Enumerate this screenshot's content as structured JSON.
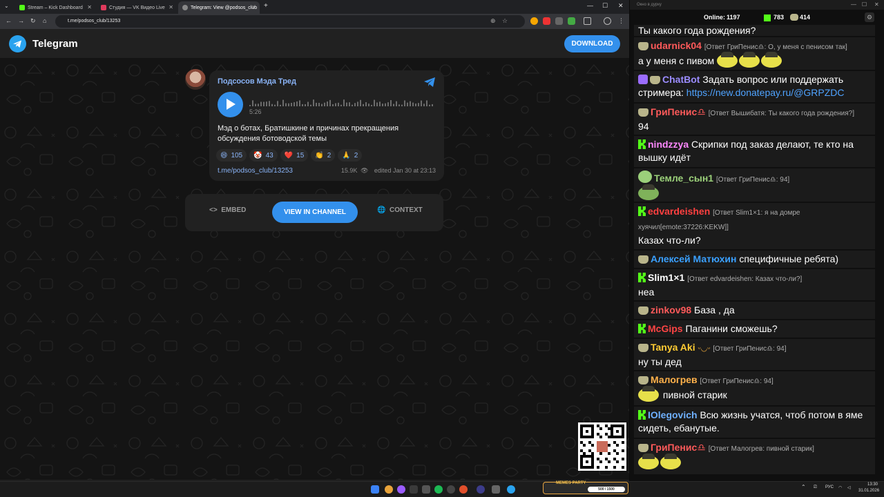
{
  "browser": {
    "tabs": [
      {
        "label": "Stream – Kick Dashboard",
        "color": "#53fc18"
      },
      {
        "label": "Студия — VK Видео Live",
        "color": "#e03a5c"
      },
      {
        "label": "Telegram: View @podsos_club",
        "color": "#888888"
      }
    ],
    "url": "t.me/podsos_club/13253",
    "new_tab": "+"
  },
  "telegram": {
    "brand": "Telegram",
    "download": "DOWNLOAD",
    "channel": "Подсосов Мэда Тред",
    "duration": "5:26",
    "message": "Мэд о ботах, Братишкине и причинах прекращения обсуждения ботоводской темы",
    "reactions": [
      {
        "emoji": "😄",
        "count": "105"
      },
      {
        "emoji": "🤡",
        "count": "43"
      },
      {
        "emoji": "❤️",
        "count": "15"
      },
      {
        "emoji": "👏",
        "count": "2"
      },
      {
        "emoji": "🙏",
        "count": "2"
      }
    ],
    "post_link": "t.me/podsos_club/13253",
    "views": "15.9K",
    "edited": "edited  Jan 30 at 23:13",
    "actions": {
      "embed": "EMBED",
      "view": "VIEW IN CHANNEL",
      "context": "CONTEXT"
    }
  },
  "chat": {
    "title": "Окно в дурку",
    "online_label": "Online:",
    "online": "1197",
    "kick_count": "783",
    "other_count": "414",
    "top_line": "Ты какого года рождения?",
    "messages": [
      {
        "user": "udarnick04",
        "color": "#ff5a5a",
        "badge": "hat",
        "reply": "[Ответ ГриПенис♎: О, у меня с пенисом так]",
        "text": "а у меня с пивом"
      },
      {
        "user": "ChatBot",
        "color": "#9b8cff",
        "badge": "bot",
        "reply": "",
        "text": "Задать вопрос или поддержать стримера:",
        "link": "https://new.donatepay.ru/@GRPZDC"
      },
      {
        "user": "ГриПенис♎",
        "color": "#ff5a5a",
        "badge": "hat",
        "reply": "[Ответ Вышибатя: Ты какого года рождения?]",
        "text": "94"
      },
      {
        "user": "nindzzya",
        "color": "#ff88ff",
        "badge": "kick",
        "reply": "",
        "text": "Скрипки под заказ делают, те кто на вышку идёт"
      },
      {
        "user": "Темле_сын1",
        "color": "#9bd07a",
        "badge": "pepe",
        "reply": "[Ответ ГриПенис♎: 94]",
        "text": ""
      },
      {
        "user": "edvardeishen",
        "color": "#ff4040",
        "badge": "kick",
        "reply": "[Ответ Slim1×1: я на домре хуячил[emote:37226:KEKW]]",
        "text": "Казах что-ли?"
      },
      {
        "user": "Алексей Матюхин",
        "color": "#3aa0ff",
        "badge": "hat",
        "reply": "",
        "text": "специфичные ребята)"
      },
      {
        "user": "Slim1×1",
        "color": "#ffffff",
        "badge": "kick",
        "reply": "[Ответ edvardeishen: Казах что-ли?]",
        "text": "неа"
      },
      {
        "user": "zinkov98",
        "color": "#ff5a5a",
        "badge": "hat",
        "reply": "",
        "text": "База , да"
      },
      {
        "user": "McGips",
        "color": "#ff4444",
        "badge": "kick",
        "reply": "",
        "text": "Паганини сможешь?"
      },
      {
        "user": "Tanya Aki",
        "color": "#ffcc33",
        "badge": "hat",
        "reply": "[Ответ ГриПенис♎: 94]",
        "text": "ну ты дед"
      },
      {
        "user": "Малогрев",
        "color": "#ffb14a",
        "badge": "hat",
        "reply": "[Ответ ГриПенис♎: 94]",
        "text": "пивной старик"
      },
      {
        "user": "IOlegovich",
        "color": "#6fb0ff",
        "badge": "kick",
        "reply": "",
        "text": "Всю жизнь учатся, чтоб потом в яме сидеть, ебанутые."
      },
      {
        "user": "ГриПенис♎",
        "color": "#ff5a5a",
        "badge": "hat",
        "reply": "[Ответ Малогрев: пивной старик]",
        "text": ""
      }
    ]
  },
  "taskbar": {
    "meme_party": "MEMES PARTY",
    "meme_progress": "500 / 1500",
    "lang": "РУС",
    "time": "13:30",
    "date": "31.01.2026"
  }
}
